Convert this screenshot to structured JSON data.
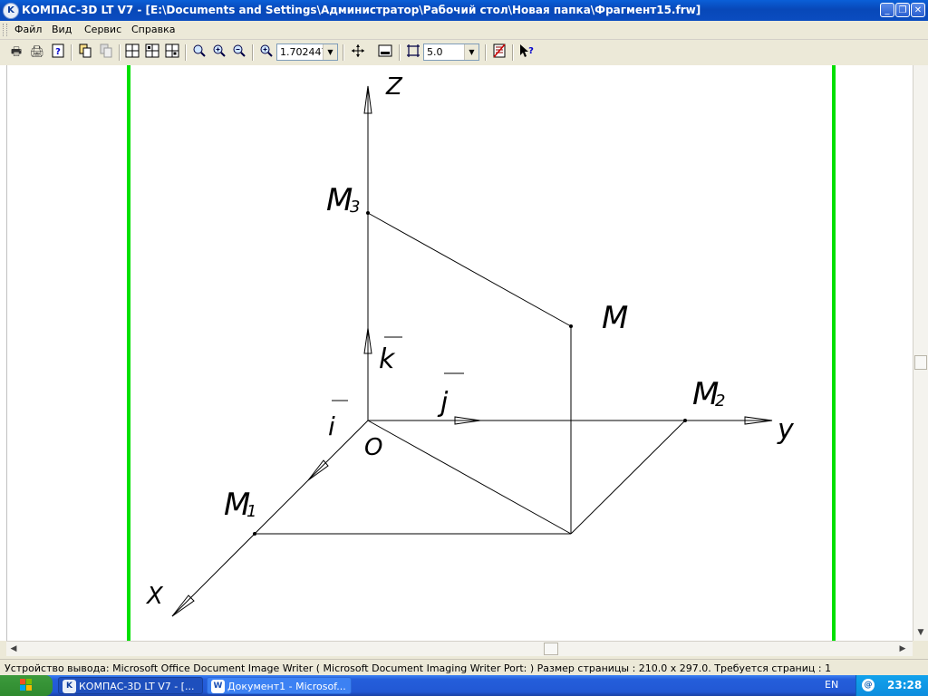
{
  "window": {
    "title": "КОМПАС-3D LT V7 - [E:\\Documents and Settings\\Администратор\\Рабочий стол\\Новая папка\\Фрагмент15.frw]",
    "app_icon": "kompas-icon",
    "buttons": {
      "minimize": "_",
      "restore": "❐",
      "close": "✕"
    }
  },
  "menu": {
    "items": [
      "Файл",
      "Вид",
      "Сервис",
      "Справка"
    ]
  },
  "toolbar": {
    "zoom_value": "1.702447",
    "step_value": "5.0",
    "icons": [
      "print-icon",
      "print-preview-icon",
      "help-doc-icon",
      "copy-props-icon",
      "paste-props-icon",
      "view-grid-1-icon",
      "view-grid-2-icon",
      "view-grid-3-icon",
      "zoom-window-icon",
      "zoom-in-icon",
      "zoom-out-icon",
      "zoom-scale-icon",
      "pan-icon",
      "show-all-icon",
      "cursor-step-icon",
      "manager-icon",
      "context-help-icon"
    ]
  },
  "drawing": {
    "labels": {
      "z_axis": "Z",
      "y_axis": "y",
      "x_axis": "X",
      "origin": "O",
      "point_m": "M",
      "point_m1": "M",
      "point_m1_sub": "1",
      "point_m2": "M",
      "point_m2_sub": "2",
      "point_m3": "M",
      "point_m3_sub": "3",
      "vec_i": "i",
      "vec_j": "j",
      "vec_k": "k"
    },
    "border_color": "#00e000"
  },
  "statusbar": {
    "text": "Устройство вывода: Microsoft Office Document Image Writer ( Microsoft Document Imaging Writer Port: )  Размер страницы : 210.0 x 297.0.  Требуется страниц : 1"
  },
  "taskbar": {
    "tasks": [
      {
        "label": "КОМПАС-3D LT V7 - [..."
      },
      {
        "label": "Документ1 - Microsof..."
      }
    ],
    "language": "EN",
    "clock": "23:28"
  }
}
